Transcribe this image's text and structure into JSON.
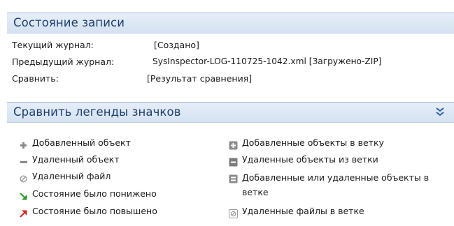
{
  "record_status": {
    "title": "Состояние записи",
    "rows": [
      {
        "label": "Текущий журнал:",
        "value": "[Создано]"
      },
      {
        "label": "Предыдущий журнал:",
        "value": "SysInspector-LOG-110725-1042.xml [Загружено-ZIP]"
      },
      {
        "label": "Сравнить:",
        "value": "[Результат сравнения]"
      }
    ]
  },
  "legend": {
    "title": "Сравнить легенды значков",
    "collapse_icon": "double-chevron-down-icon",
    "left_items": [
      {
        "icon": "plus-icon",
        "label": "Добавленный объект"
      },
      {
        "icon": "minus-icon",
        "label": "Удаленный объект"
      },
      {
        "icon": "removed-file-icon",
        "label": "Удаленный файл"
      },
      {
        "icon": "arrow-down-green-icon",
        "label": "Состояние было понижено"
      },
      {
        "icon": "arrow-up-red-icon",
        "label": "Состояние было повышено"
      }
    ],
    "right_items": [
      {
        "icon": "plus-box-icon",
        "label": "Добавленные объекты в ветку"
      },
      {
        "icon": "minus-box-icon",
        "label": "Удаленные объекты из ветки"
      },
      {
        "icon": "plus-minus-box-icon",
        "label": "Добавленные или удаленные объекты в ветке"
      },
      {
        "icon": "removed-file-box-icon",
        "label": "Удаленные файлы в ветке"
      }
    ]
  },
  "colors": {
    "header_text": "#1d3f6e",
    "header_bg": "#dce7f4",
    "green_arrow": "#2a9a2a",
    "red_arrow": "#d42a1e",
    "icon_gray": "#8a8a8a"
  }
}
